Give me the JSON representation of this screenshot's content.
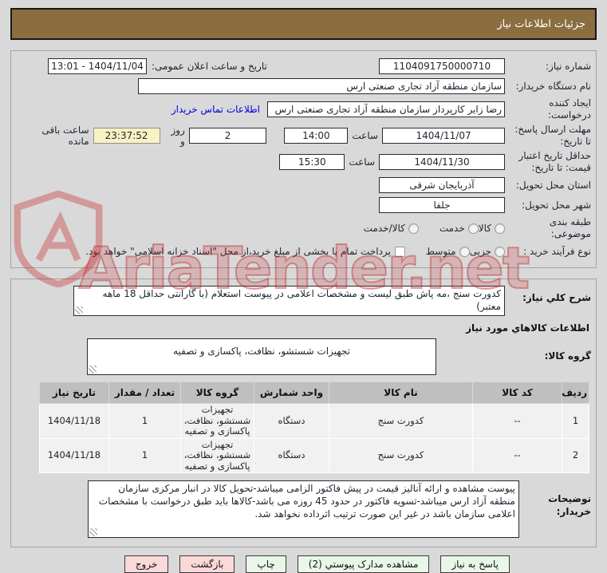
{
  "header": {
    "title": "جزئیات اطلاعات نیاز"
  },
  "watermark": {
    "text": "AriaTender.net"
  },
  "form": {
    "need_number": {
      "label": "شماره نیاز:",
      "value": "1104091750000710"
    },
    "announce_datetime": {
      "label": "تاریخ و ساعت اعلان عمومی:",
      "value": "1404/11/04 - 13:01"
    },
    "buyer_org": {
      "label": "نام دستگاه خریدار:",
      "value": "سازمان منطقه آزاد تجاری صنعتی ارس"
    },
    "request_creator": {
      "label": "ایجاد کننده درخواست:",
      "value": "رضا زایر کارپرداز سازمان منطقه آزاد تجاری صنعتی ارس",
      "contact_link": "اطلاعات تماس خریدار"
    },
    "response_deadline": {
      "label": "مهلت ارسال پاسخ: تا تاریخ:",
      "date": "1404/11/07",
      "hour_label": "ساعت",
      "time": "14:00",
      "days_value": "2",
      "days_label": "روز و",
      "countdown": "23:37:52",
      "remaining_label": "ساعت باقی مانده"
    },
    "price_validity": {
      "label": "حداقل تاریخ اعتبار قیمت: تا تاریخ:",
      "date": "1404/11/30",
      "hour_label": "ساعت",
      "time": "15:30"
    },
    "delivery_province": {
      "label": "استان محل تحویل:",
      "value": "آذربایجان شرقی"
    },
    "delivery_city": {
      "label": "شهر محل تحویل:",
      "value": "جلفا"
    },
    "subject_class": {
      "label": "طبقه بندی موضوعی:",
      "options": [
        "کالا",
        "خدمت",
        "کالا/خدمت"
      ]
    },
    "purchase_process": {
      "label": "نوع فرآیند خرید :",
      "options": [
        "جزیی",
        "متوسط"
      ],
      "checkbox_label": "پرداخت تمام یا بخشی از مبلغ خرید،از محل \"اسناد خزانه اسلامی\" خواهد بود."
    }
  },
  "need_desc": {
    "label": "شرح کلي نیاز:",
    "value": "کدورت سنج ،مه پاش طبق لیست و مشخصات اعلامی در پیوست استعلام (با گارانتی حداقل 18 ماهه معتبر)"
  },
  "goods_section": {
    "title": "اطلاعات کالاهاي مورد نیاز",
    "group_label": "گروه کالا:",
    "group_value": "تجهیزات شستشو، نظافت، پاکسازی و تصفیه"
  },
  "table": {
    "headers": [
      "ردیف",
      "کد کالا",
      "نام کالا",
      "واحد شمارش",
      "گروه کالا",
      "تعداد / مقدار",
      "تاریخ نیاز"
    ],
    "rows": [
      [
        "1",
        "--",
        "کدورت سنج",
        "دستگاه",
        "تجهیزات شستشو، نظافت، پاکسازی و تصفیه",
        "1",
        "1404/11/18"
      ],
      [
        "2",
        "--",
        "کدورت سنج",
        "دستگاه",
        "تجهیزات شستشو، نظافت، پاکسازی و تصفیه",
        "1",
        "1404/11/18"
      ]
    ]
  },
  "buyer_notes": {
    "label": "توضیحات خریدار:",
    "value": "پیوست مشاهده و ارائه آنالیز قیمت در پیش فاکتور الزامی میباشد-تحویل کالا در انبار مرکزی سازمان منطقه آزاد ارس میباشد-تسویه فاکتور در حدود 45 روزه می باشد-کالاها باید طبق درخواست با مشخصات اعلامی سازمان باشد در غیر این صورت ترتیب اثرداده نخواهد شد."
  },
  "buttons": {
    "respond": "پاسخ به نیاز",
    "view_docs": "مشاهده مدارک پیوستي (2)",
    "print": "چاپ",
    "back": "بازگشت",
    "exit": "خروج"
  },
  "colors": {
    "titlebar": "#8a6e3f",
    "watermark_red": "#c6252b",
    "link_blue": "#0000dd",
    "countdown_yellow": "#faf2c3",
    "button_green": "#e9f7e9",
    "button_pink": "#fbd9d9",
    "table_header_gray": "#bfbfbf"
  }
}
